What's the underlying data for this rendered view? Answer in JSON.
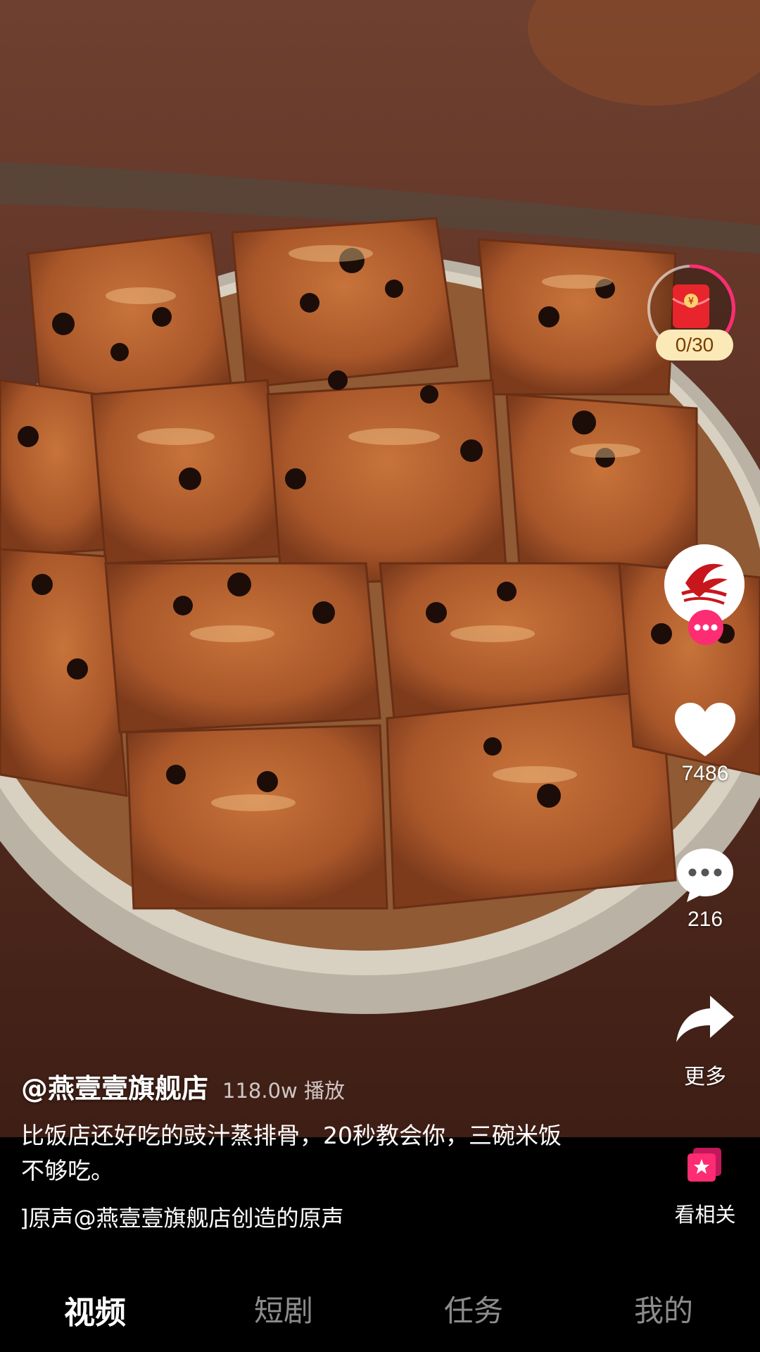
{
  "video": {
    "red_packet_progress": "0/30",
    "like_count": "7486",
    "comment_count": "216",
    "more_label": "更多",
    "related_label": "看相关"
  },
  "caption": {
    "author": "@燕壹壹旗舰店",
    "plays": "118.0w 播放",
    "description": "比饭店还好吃的豉汁蒸排骨，20秒教会你，三碗米饭不够吃。",
    "music": "]原声@燕壹壹旗舰店创造的原声"
  },
  "bottom_nav": {
    "tabs": [
      {
        "label": "视频",
        "active": true
      },
      {
        "label": "短剧",
        "active": false
      },
      {
        "label": "任务",
        "active": false
      },
      {
        "label": "我的",
        "active": false
      }
    ]
  },
  "colors": {
    "accent_pink": "#fe2c72",
    "red_packet": "#e8242c",
    "badge_bg": "#fbe9b8"
  }
}
